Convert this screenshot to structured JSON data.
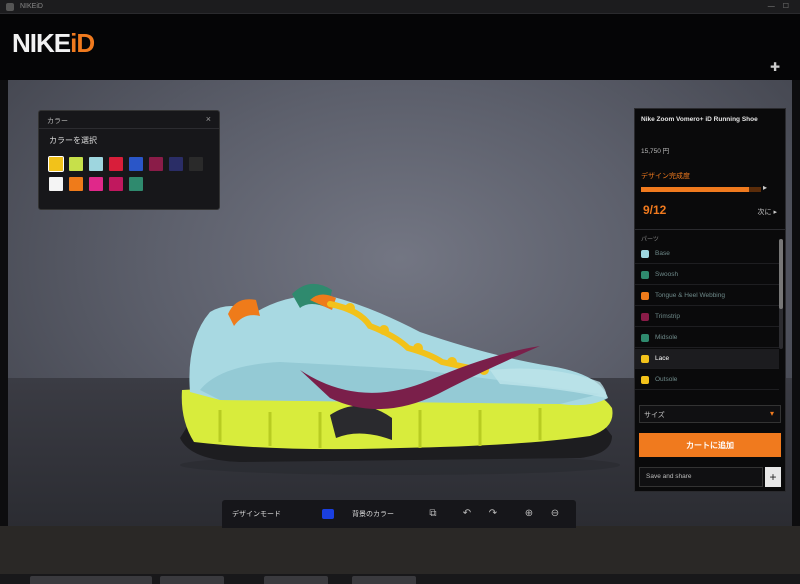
{
  "window": {
    "title": "NIKEiD"
  },
  "header": {
    "logo_text": "NIKE",
    "logo_accent": "iD",
    "accent_color": "#f07a1e"
  },
  "color_panel": {
    "header": "カラー",
    "label": "カラーを選択",
    "swatches": [
      {
        "color": "#f2c21a",
        "selected": true
      },
      {
        "color": "#c7e04a",
        "selected": false
      },
      {
        "color": "#9ed6df",
        "selected": false
      },
      {
        "color": "#d81e3a",
        "selected": false
      },
      {
        "color": "#2a56c8",
        "selected": false
      },
      {
        "color": "#8a1c48",
        "selected": false
      },
      {
        "color": "#2a2d66",
        "selected": false
      },
      {
        "color": "#2a2a2a",
        "selected": false
      },
      {
        "color": "#f4f4f4",
        "selected": false
      },
      {
        "color": "#ef7b1a",
        "selected": false
      },
      {
        "color": "#e0288a",
        "selected": false
      },
      {
        "color": "#c0185e",
        "selected": false
      },
      {
        "color": "#2f8a6e",
        "selected": false
      }
    ]
  },
  "product": {
    "name": "Nike Zoom Vomero+ iD Running Shoe",
    "price": "15,750 円",
    "progress_label": "デザイン完成度",
    "progress": 0.9,
    "step_count": "9/12",
    "next_label": "次に ▸"
  },
  "parts": {
    "header": "パーツ",
    "items": [
      {
        "label": "Base",
        "color": "#9ed6df",
        "active": false
      },
      {
        "label": "Swoosh",
        "color": "#2f8a6e",
        "active": false
      },
      {
        "label": "Tongue & Heel Webbing",
        "color": "#ef7b1a",
        "active": false
      },
      {
        "label": "Trimstrip",
        "color": "#8a1c48",
        "active": false
      },
      {
        "label": "Midsole",
        "color": "#2f8a6e",
        "active": false
      },
      {
        "label": "Lace",
        "color": "#f2c21a",
        "active": true
      },
      {
        "label": "Outsole",
        "color": "#f2c21a",
        "active": false
      }
    ]
  },
  "actions": {
    "size_label": "サイズ",
    "add_to_cart": "カートに追加",
    "save_label": "Save and share"
  },
  "toolbar": {
    "design_mode": "デザインモード",
    "bg_color_label": "背景のカラー",
    "design_mode_color": "#1a3fe0"
  }
}
